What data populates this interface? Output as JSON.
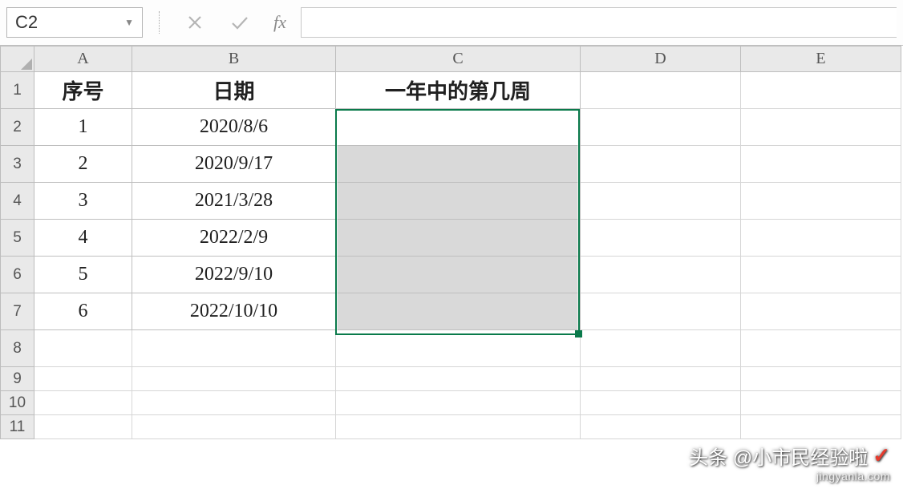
{
  "namebox": {
    "value": "C2"
  },
  "fx": {
    "label": "fx"
  },
  "formula": {
    "value": ""
  },
  "columns": [
    "A",
    "B",
    "C",
    "D",
    "E"
  ],
  "headers": {
    "A": "序号",
    "B": "日期",
    "C": "一年中的第几周"
  },
  "rows": [
    {
      "n": "1",
      "A": "1",
      "B": "2020/8/6",
      "C": ""
    },
    {
      "n": "2",
      "A": "2",
      "B": "2020/9/17",
      "C": ""
    },
    {
      "n": "3",
      "A": "3",
      "B": "2021/3/28",
      "C": ""
    },
    {
      "n": "4",
      "A": "4",
      "B": "2022/2/9",
      "C": ""
    },
    {
      "n": "5",
      "A": "5",
      "B": "2022/9/10",
      "C": ""
    },
    {
      "n": "6",
      "A": "6",
      "B": "2022/10/10",
      "C": ""
    }
  ],
  "empty_rows": [
    "8",
    "9",
    "10",
    "11"
  ],
  "selection": {
    "active": "C2",
    "range": "C2:C7"
  },
  "watermark": {
    "line1": "头条 @小市民经验啦",
    "line2": "jingyanla.com"
  }
}
